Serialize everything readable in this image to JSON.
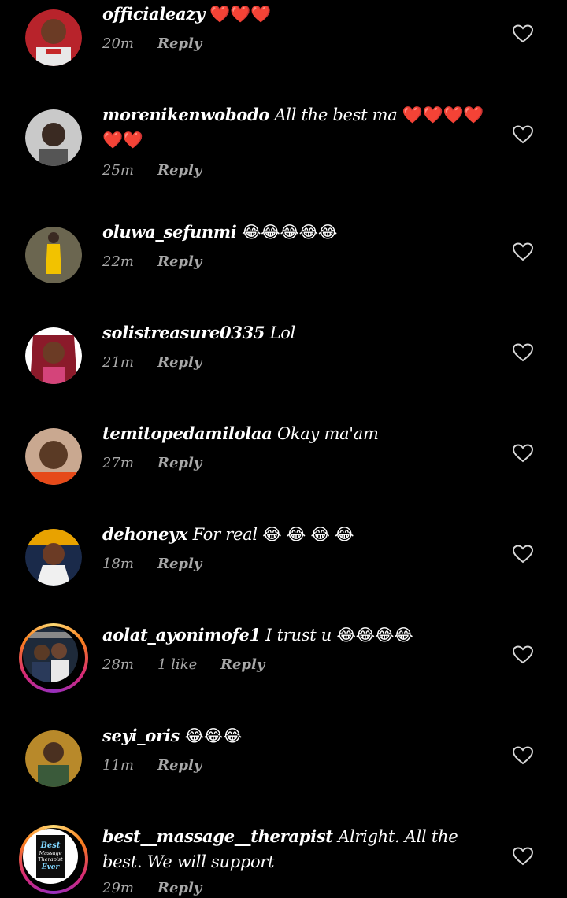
{
  "colors": {
    "background": "#000000",
    "text": "#ffffff",
    "meta": "#a8a8a8",
    "story_ring": [
      "#feda75",
      "#fa7e1e",
      "#d62976",
      "#962fbf"
    ]
  },
  "comments": [
    {
      "username": "officialeazy",
      "text": "",
      "emoji": "❤️❤️❤️",
      "time": "20m",
      "likes": "",
      "reply": "Reply",
      "heart_icon": "heart-outline-icon"
    },
    {
      "username": "morenikenwobodo",
      "text": "All the best ma",
      "emoji": "❤️❤️❤️❤️❤️❤️",
      "time": "25m",
      "likes": "",
      "reply": "Reply",
      "heart_icon": "heart-outline-icon"
    },
    {
      "username": "oluwa_sefunmi",
      "text": "",
      "emoji": "😂😂😂😂😂",
      "time": "22m",
      "likes": "",
      "reply": "Reply",
      "heart_icon": "heart-outline-icon"
    },
    {
      "username": "solistreasure0335",
      "text": "Lol",
      "emoji": "",
      "time": "21m",
      "likes": "",
      "reply": "Reply",
      "heart_icon": "heart-outline-icon"
    },
    {
      "username": "temitopedamilolaa",
      "text": "Okay ma'am",
      "emoji": "",
      "time": "27m",
      "likes": "",
      "reply": "Reply",
      "heart_icon": "heart-outline-icon"
    },
    {
      "username": "dehoneyx",
      "text": "For real",
      "emoji": "😂 😂 😂 😂",
      "time": "18m",
      "likes": "",
      "reply": "Reply",
      "heart_icon": "heart-outline-icon"
    },
    {
      "username": "aolat_ayonimofe1",
      "text": "I trust u",
      "emoji": "😂😂😂😂",
      "time": "28m",
      "likes": "1 like",
      "reply": "Reply",
      "heart_icon": "heart-outline-icon"
    },
    {
      "username": "seyi_oris",
      "text": "",
      "emoji": "😂😂😂",
      "time": "11m",
      "likes": "",
      "reply": "Reply",
      "heart_icon": "heart-outline-icon"
    },
    {
      "username": "best__massage__therapist",
      "text": "Alright.  All the best.  We will support",
      "emoji": "",
      "time": "29m",
      "likes": "",
      "reply": "Reply",
      "heart_icon": "heart-outline-icon",
      "avatar_text": [
        "Best",
        "Massage",
        "Therapist",
        "Ever"
      ]
    }
  ]
}
